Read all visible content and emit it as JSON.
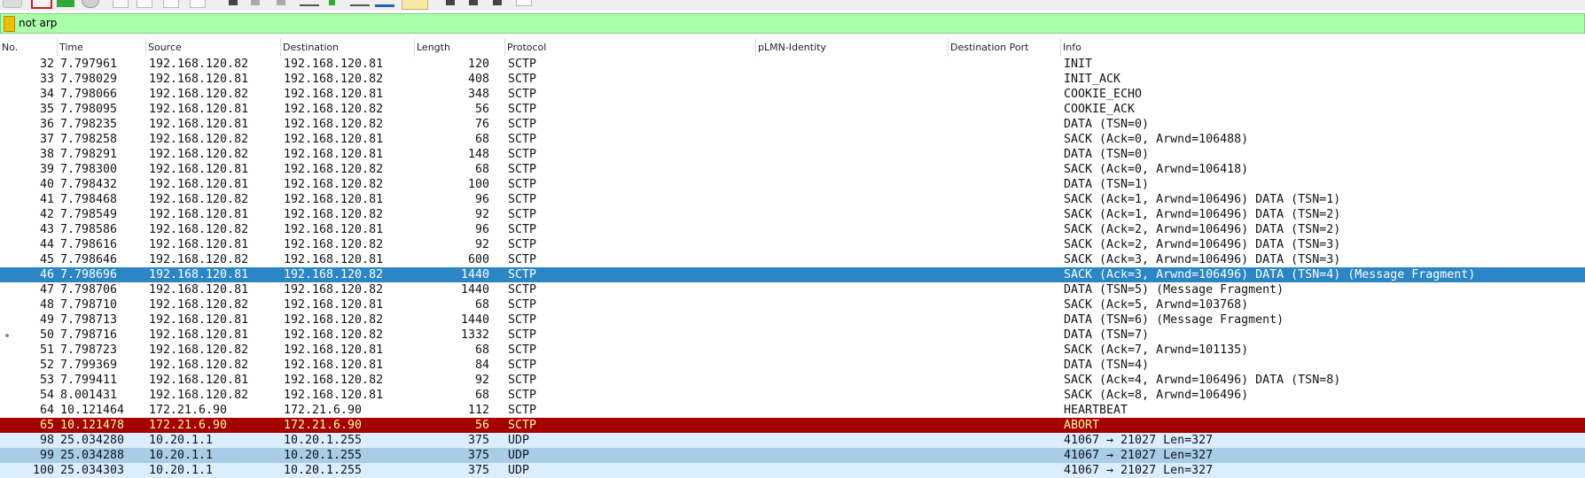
{
  "filter": {
    "value": "not arp"
  },
  "columns": [
    "No.",
    "Time",
    "Source",
    "Destination",
    "Length",
    "Protocol",
    "pLMN-Identity",
    "Destination Port",
    "Info"
  ],
  "packets": [
    {
      "no": "32",
      "time": "7.797961",
      "src": "192.168.120.82",
      "dst": "192.168.120.81",
      "len": "120",
      "proto": "SCTP",
      "info": "INIT",
      "style": "sctp"
    },
    {
      "no": "33",
      "time": "7.798029",
      "src": "192.168.120.81",
      "dst": "192.168.120.82",
      "len": "408",
      "proto": "SCTP",
      "info": "INIT_ACK",
      "style": "sctp"
    },
    {
      "no": "34",
      "time": "7.798066",
      "src": "192.168.120.82",
      "dst": "192.168.120.81",
      "len": "348",
      "proto": "SCTP",
      "info": "COOKIE_ECHO",
      "style": "sctp"
    },
    {
      "no": "35",
      "time": "7.798095",
      "src": "192.168.120.81",
      "dst": "192.168.120.82",
      "len": "56",
      "proto": "SCTP",
      "info": "COOKIE_ACK",
      "style": "sctp"
    },
    {
      "no": "36",
      "time": "7.798235",
      "src": "192.168.120.81",
      "dst": "192.168.120.82",
      "len": "76",
      "proto": "SCTP",
      "info": "DATA (TSN=0)",
      "style": "sctp"
    },
    {
      "no": "37",
      "time": "7.798258",
      "src": "192.168.120.82",
      "dst": "192.168.120.81",
      "len": "68",
      "proto": "SCTP",
      "info": "SACK (Ack=0, Arwnd=106488)",
      "style": "sctp"
    },
    {
      "no": "38",
      "time": "7.798291",
      "src": "192.168.120.82",
      "dst": "192.168.120.81",
      "len": "148",
      "proto": "SCTP",
      "info": "DATA (TSN=0)",
      "style": "sctp"
    },
    {
      "no": "39",
      "time": "7.798300",
      "src": "192.168.120.81",
      "dst": "192.168.120.82",
      "len": "68",
      "proto": "SCTP",
      "info": "SACK (Ack=0, Arwnd=106418)",
      "style": "sctp"
    },
    {
      "no": "40",
      "time": "7.798432",
      "src": "192.168.120.81",
      "dst": "192.168.120.82",
      "len": "100",
      "proto": "SCTP",
      "info": "DATA (TSN=1)",
      "style": "sctp"
    },
    {
      "no": "41",
      "time": "7.798468",
      "src": "192.168.120.82",
      "dst": "192.168.120.81",
      "len": "96",
      "proto": "SCTP",
      "info": "SACK (Ack=1, Arwnd=106496) DATA (TSN=1)",
      "style": "sctp"
    },
    {
      "no": "42",
      "time": "7.798549",
      "src": "192.168.120.81",
      "dst": "192.168.120.82",
      "len": "92",
      "proto": "SCTP",
      "info": "SACK (Ack=1, Arwnd=106496) DATA (TSN=2)",
      "style": "sctp"
    },
    {
      "no": "43",
      "time": "7.798586",
      "src": "192.168.120.82",
      "dst": "192.168.120.81",
      "len": "96",
      "proto": "SCTP",
      "info": "SACK (Ack=2, Arwnd=106496) DATA (TSN=2)",
      "style": "sctp"
    },
    {
      "no": "44",
      "time": "7.798616",
      "src": "192.168.120.81",
      "dst": "192.168.120.82",
      "len": "92",
      "proto": "SCTP",
      "info": "SACK (Ack=2, Arwnd=106496) DATA (TSN=3)",
      "style": "sctp"
    },
    {
      "no": "45",
      "time": "7.798646",
      "src": "192.168.120.82",
      "dst": "192.168.120.81",
      "len": "600",
      "proto": "SCTP",
      "info": "SACK (Ack=3, Arwnd=106496) DATA (TSN=3)",
      "style": "sctp"
    },
    {
      "no": "46",
      "time": "7.798696",
      "src": "192.168.120.81",
      "dst": "192.168.120.82",
      "len": "1440",
      "proto": "SCTP",
      "info": "SACK (Ack=3, Arwnd=106496) DATA (TSN=4) (Message Fragment)",
      "style": "selected"
    },
    {
      "no": "47",
      "time": "7.798706",
      "src": "192.168.120.81",
      "dst": "192.168.120.82",
      "len": "1440",
      "proto": "SCTP",
      "info": "DATA (TSN=5) (Message Fragment)",
      "style": "sctp"
    },
    {
      "no": "48",
      "time": "7.798710",
      "src": "192.168.120.82",
      "dst": "192.168.120.81",
      "len": "68",
      "proto": "SCTP",
      "info": "SACK (Ack=5, Arwnd=103768)",
      "style": "sctp"
    },
    {
      "no": "49",
      "time": "7.798713",
      "src": "192.168.120.81",
      "dst": "192.168.120.82",
      "len": "1440",
      "proto": "SCTP",
      "info": "DATA (TSN=6) (Message Fragment)",
      "style": "sctp"
    },
    {
      "no": "50",
      "time": "7.798716",
      "src": "192.168.120.81",
      "dst": "192.168.120.82",
      "len": "1332",
      "proto": "SCTP",
      "info": "DATA (TSN=7)",
      "style": "sctp",
      "marker": true
    },
    {
      "no": "51",
      "time": "7.798723",
      "src": "192.168.120.82",
      "dst": "192.168.120.81",
      "len": "68",
      "proto": "SCTP",
      "info": "SACK (Ack=7, Arwnd=101135)",
      "style": "sctp"
    },
    {
      "no": "52",
      "time": "7.799369",
      "src": "192.168.120.82",
      "dst": "192.168.120.81",
      "len": "84",
      "proto": "SCTP",
      "info": "DATA (TSN=4)",
      "style": "sctp"
    },
    {
      "no": "53",
      "time": "7.799411",
      "src": "192.168.120.81",
      "dst": "192.168.120.82",
      "len": "92",
      "proto": "SCTP",
      "info": "SACK (Ack=4, Arwnd=106496) DATA (TSN=8)",
      "style": "sctp"
    },
    {
      "no": "54",
      "time": "8.001431",
      "src": "192.168.120.82",
      "dst": "192.168.120.81",
      "len": "68",
      "proto": "SCTP",
      "info": "SACK (Ack=8, Arwnd=106496)",
      "style": "sctp"
    },
    {
      "no": "64",
      "time": "10.121464",
      "src": "172.21.6.90",
      "dst": "172.21.6.90",
      "len": "112",
      "proto": "SCTP",
      "info": "HEARTBEAT",
      "style": "sctp"
    },
    {
      "no": "65",
      "time": "10.121478",
      "src": "172.21.6.90",
      "dst": "172.21.6.90",
      "len": "56",
      "proto": "SCTP",
      "info": "ABORT",
      "style": "abort"
    },
    {
      "no": "98",
      "time": "25.034280",
      "src": "10.20.1.1",
      "dst": "10.20.1.255",
      "len": "375",
      "proto": "UDP",
      "info": "41067 → 21027 Len=327",
      "style": "udp"
    },
    {
      "no": "99",
      "time": "25.034288",
      "src": "10.20.1.1",
      "dst": "10.20.1.255",
      "len": "375",
      "proto": "UDP",
      "info": "41067 → 21027 Len=327",
      "style": "udp-alt"
    },
    {
      "no": "100",
      "time": "25.034303",
      "src": "10.20.1.1",
      "dst": "10.20.1.255",
      "len": "375",
      "proto": "UDP",
      "info": "41067 → 21027 Len=327",
      "style": "udp"
    }
  ]
}
